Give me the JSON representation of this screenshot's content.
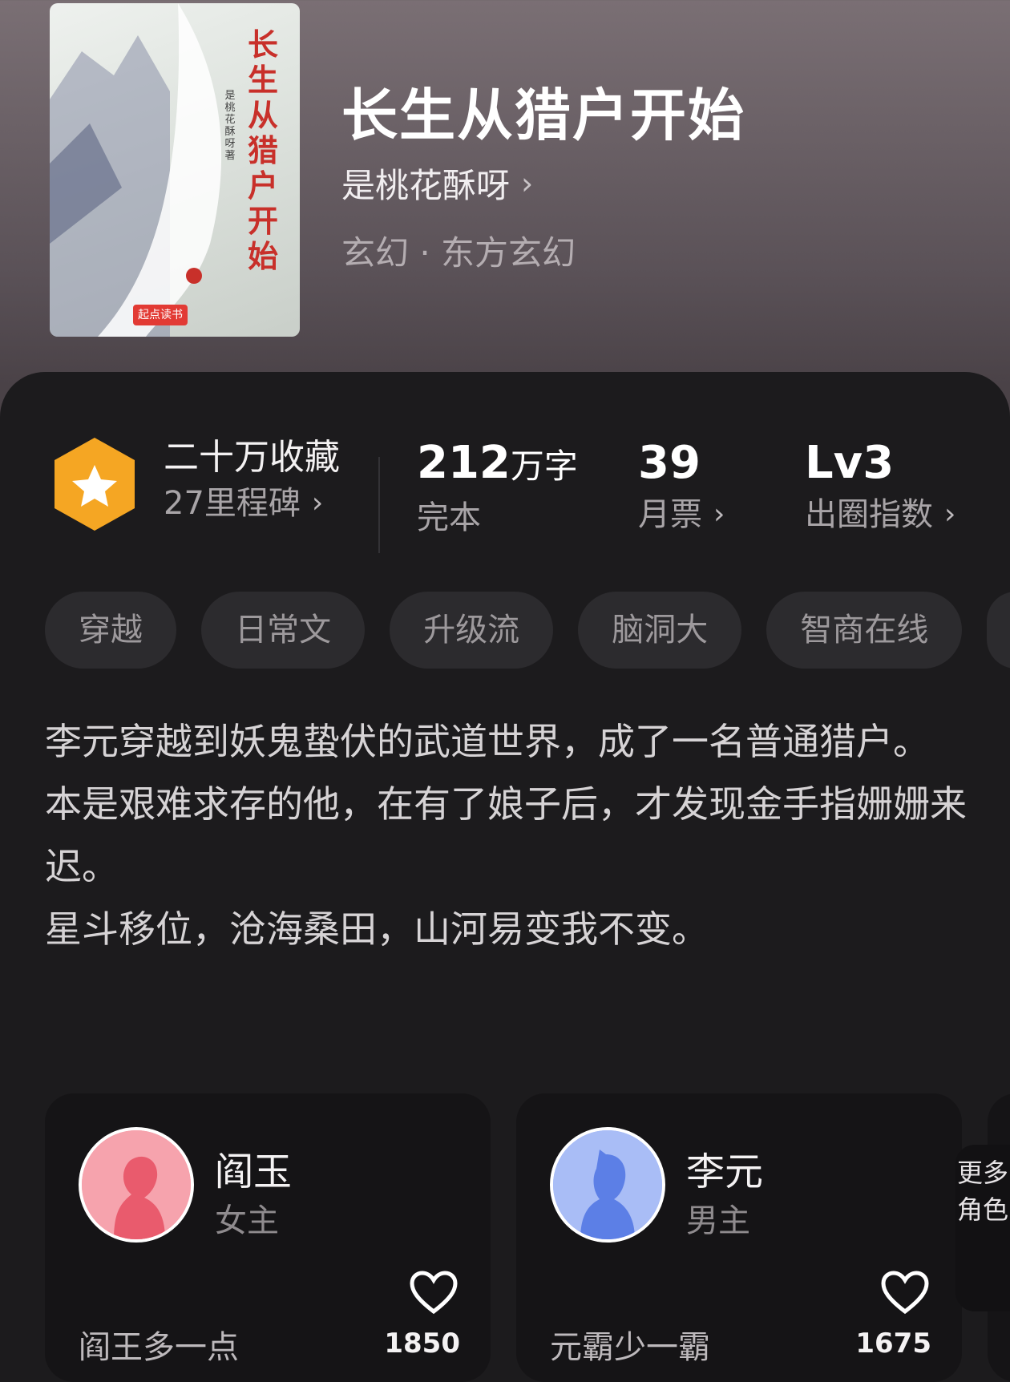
{
  "book": {
    "title": "长生从猎户开始",
    "author": "是桃花酥呀",
    "genre": "玄幻 · 东方玄幻",
    "cover": {
      "title_vertical": "长生从猎户开始",
      "author_vertical": "是桃花酥呀 著",
      "publisher": "起点读书"
    }
  },
  "stats": {
    "collect_title": "二十万收藏",
    "collect_sub": "27里程碑",
    "words_number": "212",
    "words_unit": "万字",
    "status": "完本",
    "votes": "39",
    "votes_label": "月票",
    "level": "Lv3",
    "level_label": "出圈指数"
  },
  "tags": [
    "穿越",
    "日常文",
    "升级流",
    "脑洞大",
    "智商在线"
  ],
  "description": [
    "李元穿越到妖鬼蛰伏的武道世界，成了一名普通猎户。",
    "本是艰难求存的他，在有了娘子后，才发现金手指姗姗来迟。",
    "星斗移位，沧海桑田，山河易变我不变。"
  ],
  "characters": [
    {
      "name": "阎玉",
      "role": "女主",
      "line": "阎王多一点",
      "likes": "1850",
      "color": "#f07a86"
    },
    {
      "name": "李元",
      "role": "男主",
      "line": "元霸少一霸",
      "likes": "1675",
      "color": "#6f8ff0"
    }
  ],
  "more_roles": "更多角色",
  "icons": {
    "chevron": "›",
    "badge": "star-hexagon-icon",
    "heart": "heart-outline-icon"
  },
  "colors": {
    "badge": "#f5a623",
    "accent": "#ffffff"
  }
}
